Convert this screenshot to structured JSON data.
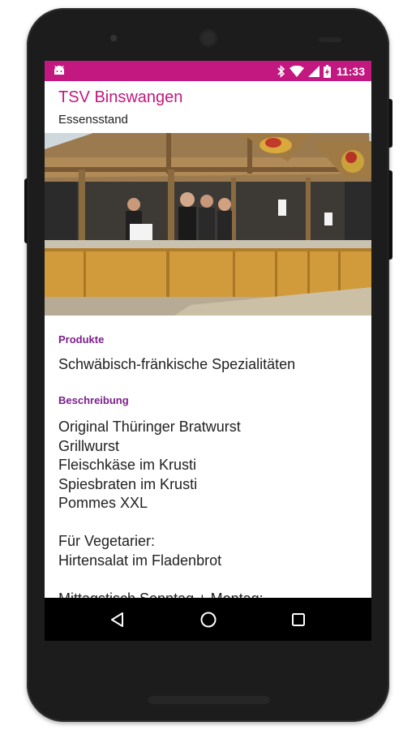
{
  "status_bar": {
    "time": "11:33",
    "color": "#c2187f",
    "icons": [
      "android-icon",
      "bluetooth-icon",
      "wifi-icon",
      "cell-signal-icon",
      "battery-charging-icon"
    ]
  },
  "header": {
    "title": "TSV Binswangen",
    "subtitle": "Essensstand",
    "title_color": "#c2187f"
  },
  "photo": {
    "icon": "food-stand-photo"
  },
  "products": {
    "label": "Produkte",
    "value": "Schwäbisch-fränkische Spezialitäten"
  },
  "description": {
    "label": "Beschreibung",
    "lines": [
      "Original Thüringer Bratwurst",
      "Grillwurst",
      "Fleischkäse im Krusti",
      "Spiesbraten im Krusti",
      "Pommes XXL",
      "",
      "Für Vegetarier:",
      "Hirtensalat im Fladenbrot",
      "",
      "Mittagstisch Sonntag + Montag:"
    ]
  },
  "nav_bar": {
    "icons": [
      "back-icon",
      "home-icon",
      "recents-icon"
    ]
  }
}
